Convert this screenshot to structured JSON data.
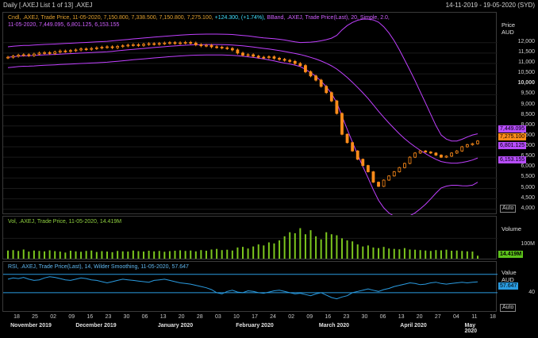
{
  "header": {
    "title": "Daily [.AXEJ List 1 of 13] .AXEJ",
    "date_range": "14-11-2019 - 19-05-2020 (SYD)"
  },
  "price_legend": {
    "line1_part1": "Cndl, .AXEJ, Trade Price, 11-05-2020, 7,150.800, 7,338.500, 7,150.800, 7,275.100,",
    "line1_change": "+124.300, (+1.74%),",
    "line1_part2": "BBand, .AXEJ, Trade Price(Last), 20, Simple, 2.0,",
    "line2": "11-05-2020, 7,449.095, 6,801.125, 6,153.155"
  },
  "price_axis": {
    "header_line1": "Price",
    "header_line2": "AUD",
    "ticks": [
      "12,000",
      "11,500",
      "11,000",
      "10,500",
      "10,000",
      "9,500",
      "9,000",
      "8,500",
      "8,000",
      "7,500",
      "7,000",
      "6,500",
      "6,000",
      "5,500",
      "5,000",
      "4,500",
      "4,000"
    ],
    "tags": {
      "bb_upper": "7,449.095",
      "last": "7,275.100",
      "bb_mid": "6,801.125",
      "bb_lower": "6,153.155"
    },
    "auto": "Auto"
  },
  "vol_legend": "Vol, .AXEJ, Trade Price, 11-05-2020, 14.419M",
  "vol_axis": {
    "header": "Volume",
    "tick": "100M",
    "tag": "14.419M"
  },
  "rsi_legend": "RSI, .AXEJ, Trade Price(Last), 14, Wilder Smoothing, 11-05-2020, 57.647",
  "rsi_axis": {
    "header_line1": "Value",
    "header_line2": "AUD",
    "tag": "57.647",
    "tick": "40",
    "auto": "Auto"
  },
  "x_axis": {
    "days": [
      "18",
      "25",
      "02",
      "09",
      "16",
      "23",
      "30",
      "06",
      "13",
      "20",
      "28",
      "03",
      "10",
      "17",
      "24",
      "02",
      "09",
      "16",
      "23",
      "30",
      "06",
      "13",
      "20",
      "27",
      "04",
      "11",
      "18"
    ],
    "months": [
      "November 2019",
      "December 2019",
      "January 2020",
      "February 2020",
      "March 2020",
      "April 2020",
      "May 2020"
    ]
  },
  "colors": {
    "candle": "#ff8c1a",
    "bband": "#c040ff",
    "volume": "#7cc61e",
    "rsi": "#2a9be0",
    "rsi_band": "#2a9be0",
    "tag_purple": "#b84dff",
    "tag_orange": "#ff8c1a",
    "tag_green": "#5cc21a"
  },
  "chart_data": {
    "type": "candlestick",
    "closes": [
      11300,
      11350,
      11400,
      11420,
      11380,
      11450,
      11500,
      11520,
      11480,
      11550,
      11600,
      11580,
      11620,
      11650,
      11700,
      11680,
      11720,
      11750,
      11780,
      11800,
      11760,
      11820,
      11850,
      11880,
      11900,
      11870,
      11920,
      11950,
      11930,
      11960,
      11980,
      12000,
      11970,
      11990,
      12010,
      11980,
      11900,
      11850,
      11870,
      11800,
      11780,
      11750,
      11720,
      11650,
      11500,
      11400,
      11420,
      11350,
      11300,
      11280,
      11320,
      11250,
      11200,
      11150,
      11100,
      11000,
      10900,
      10600,
      10400,
      10200,
      9900,
      9600,
      9200,
      8600,
      7600,
      7200,
      6800,
      6400,
      6100,
      5800,
      5300,
      5100,
      5400,
      5600,
      5800,
      6000,
      6200,
      6500,
      6700,
      6800,
      6750,
      6700,
      6600,
      6500,
      6550,
      6700,
      6800,
      7000,
      7100,
      7150,
      7275
    ],
    "bb_upper_ref": 7449.095,
    "bb_mid_ref": 6801.125,
    "bb_lower_ref": 6153.155,
    "ylim": [
      3800,
      12600
    ],
    "volume": [
      40,
      42,
      38,
      45,
      35,
      40,
      38,
      36,
      41,
      37,
      35,
      30,
      39,
      36,
      34,
      38,
      40,
      33,
      37,
      35,
      32,
      38,
      36,
      35,
      40,
      37,
      35,
      39,
      36,
      38,
      34,
      37,
      39,
      41,
      38,
      40,
      36,
      42,
      39,
      45,
      48,
      42,
      44,
      40,
      55,
      58,
      50,
      60,
      70,
      65,
      80,
      75,
      90,
      110,
      130,
      125,
      150,
      120,
      140,
      110,
      95,
      130,
      120,
      115,
      100,
      90,
      85,
      70,
      60,
      65,
      55,
      52,
      58,
      50,
      48,
      46,
      52,
      45,
      44,
      42,
      40,
      38,
      42,
      41,
      44,
      39,
      40,
      38,
      36,
      35,
      14.419
    ],
    "rsi": [
      62,
      64,
      63,
      65,
      62,
      60,
      61,
      64,
      66,
      65,
      63,
      61,
      60,
      62,
      64,
      63,
      61,
      60,
      58,
      56,
      58,
      60,
      62,
      61,
      60,
      59,
      58,
      57,
      60,
      61,
      62,
      60,
      58,
      56,
      55,
      54,
      52,
      50,
      48,
      45,
      40,
      38,
      42,
      44,
      41,
      40,
      43,
      42,
      40,
      39,
      41,
      43,
      44,
      42,
      40,
      38,
      39,
      37,
      35,
      38,
      40,
      36,
      32,
      30,
      33,
      35,
      40,
      42,
      44,
      46,
      44,
      42,
      45,
      47,
      50,
      52,
      54,
      56,
      55,
      53,
      54,
      56,
      57,
      55,
      54,
      55,
      56,
      57,
      56,
      57,
      57.647
    ],
    "rsi_band": [
      40,
      70
    ]
  }
}
